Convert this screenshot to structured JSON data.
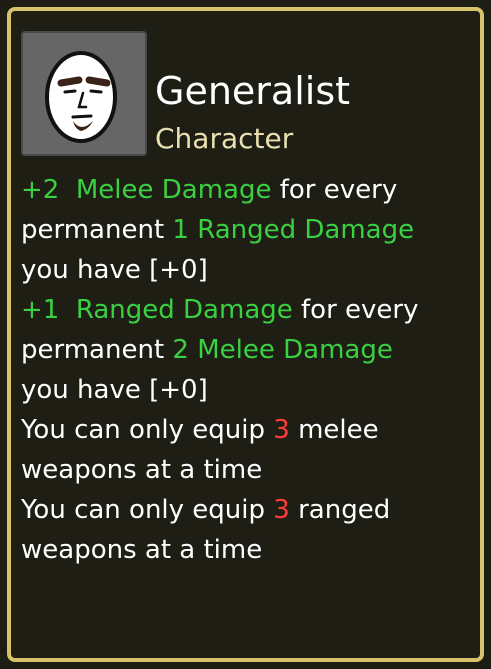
{
  "item": {
    "name": "Generalist",
    "type": "Character"
  },
  "colors": {
    "border": "#d6c36a",
    "background": "#1e1e15",
    "stat_green": "#39d140",
    "number_red": "#ff3a3a",
    "type_text": "#e8e0b0"
  },
  "portrait": {
    "icon": "egg-face-with-goatee-icon"
  },
  "effects": {
    "e1": {
      "l1_value": "+2",
      "l1_stat": "Melee Damage",
      "l1_rest": " for every",
      "l2_pre": "permanent ",
      "l2_stat": "1 Ranged Damage",
      "l3": "you have [+0]"
    },
    "e2": {
      "l1_value": "+1",
      "l1_stat": "Ranged Damage",
      "l1_rest": " for every",
      "l2_pre": "permanent ",
      "l2_stat": "2 Melee Damage",
      "l3": "you have [+0]"
    },
    "e3": {
      "l1_pre": "You can only equip ",
      "l1_num": "3",
      "l1_post": " melee",
      "l2": "weapons at a time"
    },
    "e4": {
      "l1_pre": "You can only equip ",
      "l1_num": "3",
      "l1_post": " ranged",
      "l2": "weapons at a time"
    }
  }
}
